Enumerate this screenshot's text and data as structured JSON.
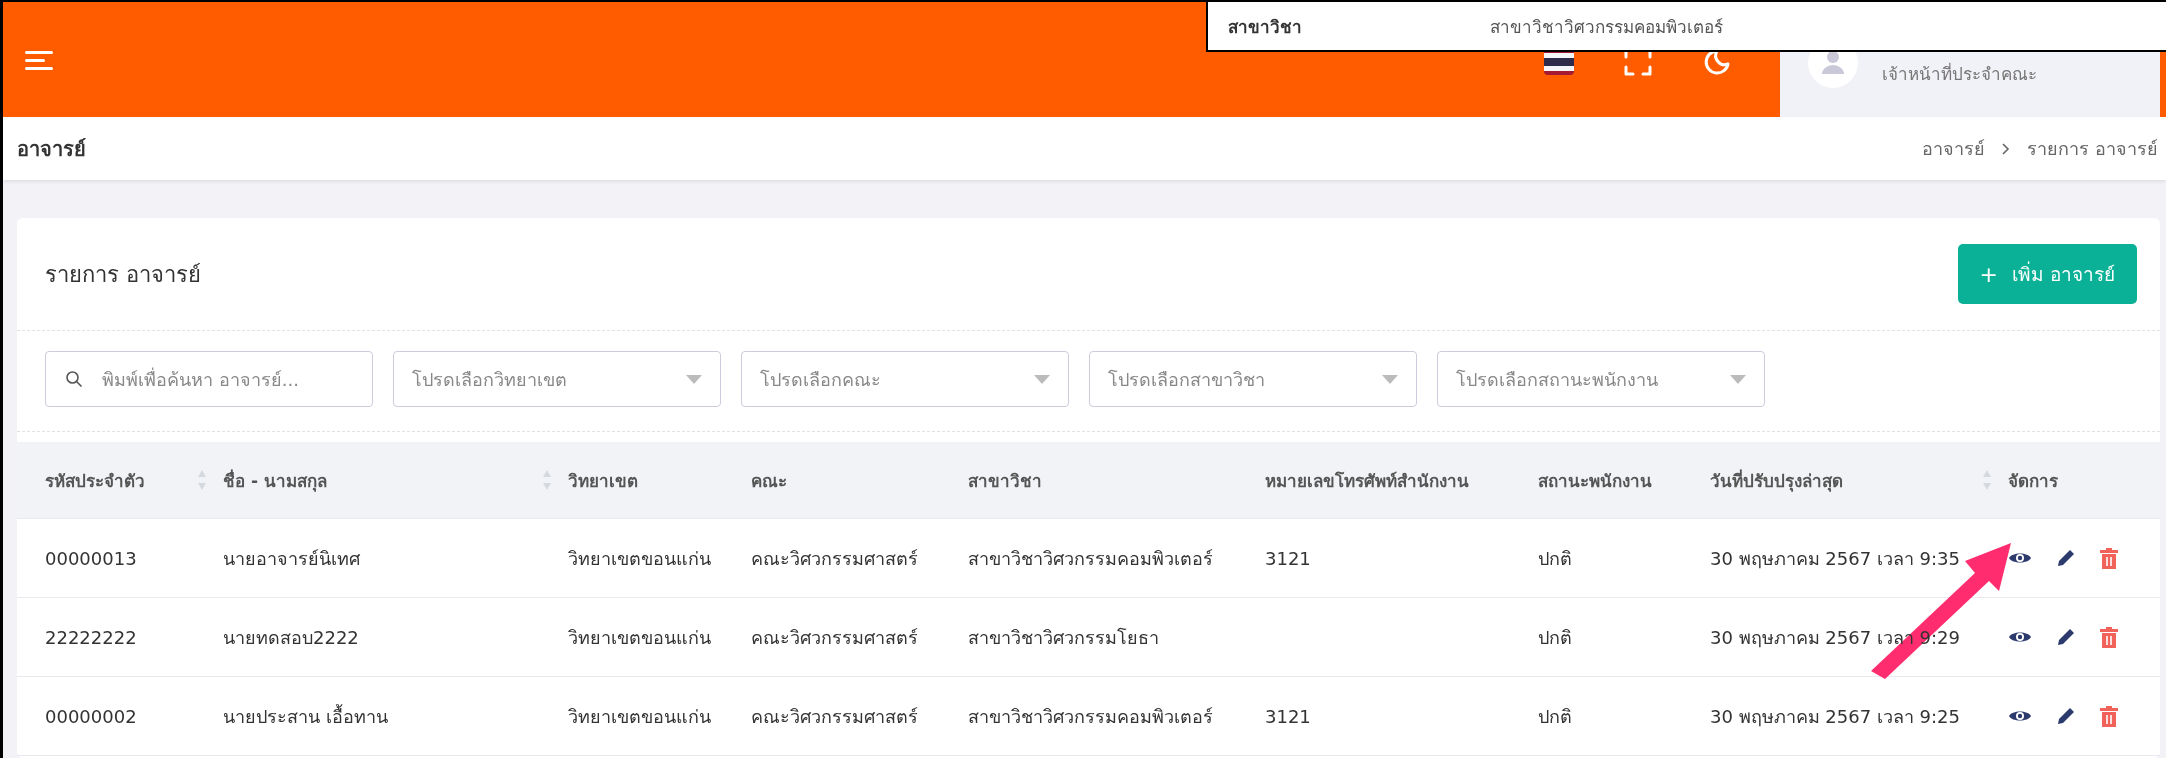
{
  "popup": {
    "label": "สาขาวิชา",
    "value": "สาขาวิชาวิศวกรรมคอมพิวเตอร์"
  },
  "user": {
    "role": "เจ้าหน้าที่ประจำคณะ"
  },
  "page_title": "อาจารย์",
  "breadcrumb": [
    "อาจารย์",
    "รายการ อาจารย์"
  ],
  "card": {
    "title": "รายการ อาจารย์",
    "add_button": {
      "icon": "+",
      "label": "เพิ่ม อาจารย์"
    }
  },
  "search": {
    "placeholder": "พิมพ์เพื่อค้นหา อาจารย์..."
  },
  "filters": [
    {
      "placeholder": "โปรดเลือกวิทยาเขต"
    },
    {
      "placeholder": "โปรดเลือกคณะ"
    },
    {
      "placeholder": "โปรดเลือกสาขาวิชา"
    },
    {
      "placeholder": "โปรดเลือกสถานะพนักงาน"
    }
  ],
  "table": {
    "columns": [
      {
        "label": "รหัสประจำตัว",
        "sortable": true
      },
      {
        "label": "ชื่อ - นามสกุล",
        "sortable": true
      },
      {
        "label": "วิทยาเขต",
        "sortable": false
      },
      {
        "label": "คณะ",
        "sortable": false
      },
      {
        "label": "สาขาวิชา",
        "sortable": false
      },
      {
        "label": "หมายเลขโทรศัพท์สำนักงาน",
        "sortable": false
      },
      {
        "label": "สถานะพนักงาน",
        "sortable": false
      },
      {
        "label": "วันที่ปรับปรุงล่าสุด",
        "sortable": true
      },
      {
        "label": "จัดการ",
        "sortable": false
      }
    ],
    "rows": [
      {
        "cells": [
          "00000013",
          "นายอาจารย์นิเทศ",
          "วิทยาเขตขอนแก่น",
          "คณะวิศวกรรมศาสตร์",
          "สาขาวิชาวิศวกรรมคอมพิวเตอร์",
          "3121",
          "ปกติ",
          "30 พฤษภาคม 2567 เวลา 9:35"
        ]
      },
      {
        "cells": [
          "22222222",
          "นายทดสอบ2222",
          "วิทยาเขตขอนแก่น",
          "คณะวิศวกรรมศาสตร์",
          "สาขาวิชาวิศวกรรมโยธา",
          "",
          "ปกติ",
          "30 พฤษภาคม 2567 เวลา 9:29"
        ]
      },
      {
        "cells": [
          "00000002",
          "นายประสาน เอื้อทาน",
          "วิทยาเขตขอนแก่น",
          "คณะวิศวกรรมศาสตร์",
          "สาขาวิชาวิศวกรรมคอมพิวเตอร์",
          "3121",
          "ปกติ",
          "30 พฤษภาคม 2567 เวลา 9:25"
        ]
      }
    ]
  }
}
